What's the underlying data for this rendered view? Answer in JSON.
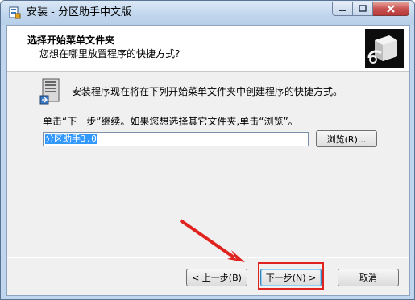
{
  "window": {
    "title": "安装 - 分区助手中文版"
  },
  "header": {
    "title": "选择开始菜单文件夹",
    "subtitle": "您想在哪里放置程序的快捷方式?"
  },
  "body": {
    "description": "安装程序现在将在下列开始菜单文件夹中创建程序的快捷方式。",
    "instruction": "单击“下一步”继续。如果您想选择其它文件夹,单击“浏览”。",
    "folder_value": "分区助手3.0",
    "browse_label": "浏览(R)..."
  },
  "buttons": {
    "back_label": "< 上一步(B)",
    "next_label": "下一步(N) >",
    "cancel_label": "取消"
  },
  "colors": {
    "highlight": "#e0231e",
    "selection": "#3399ff"
  }
}
